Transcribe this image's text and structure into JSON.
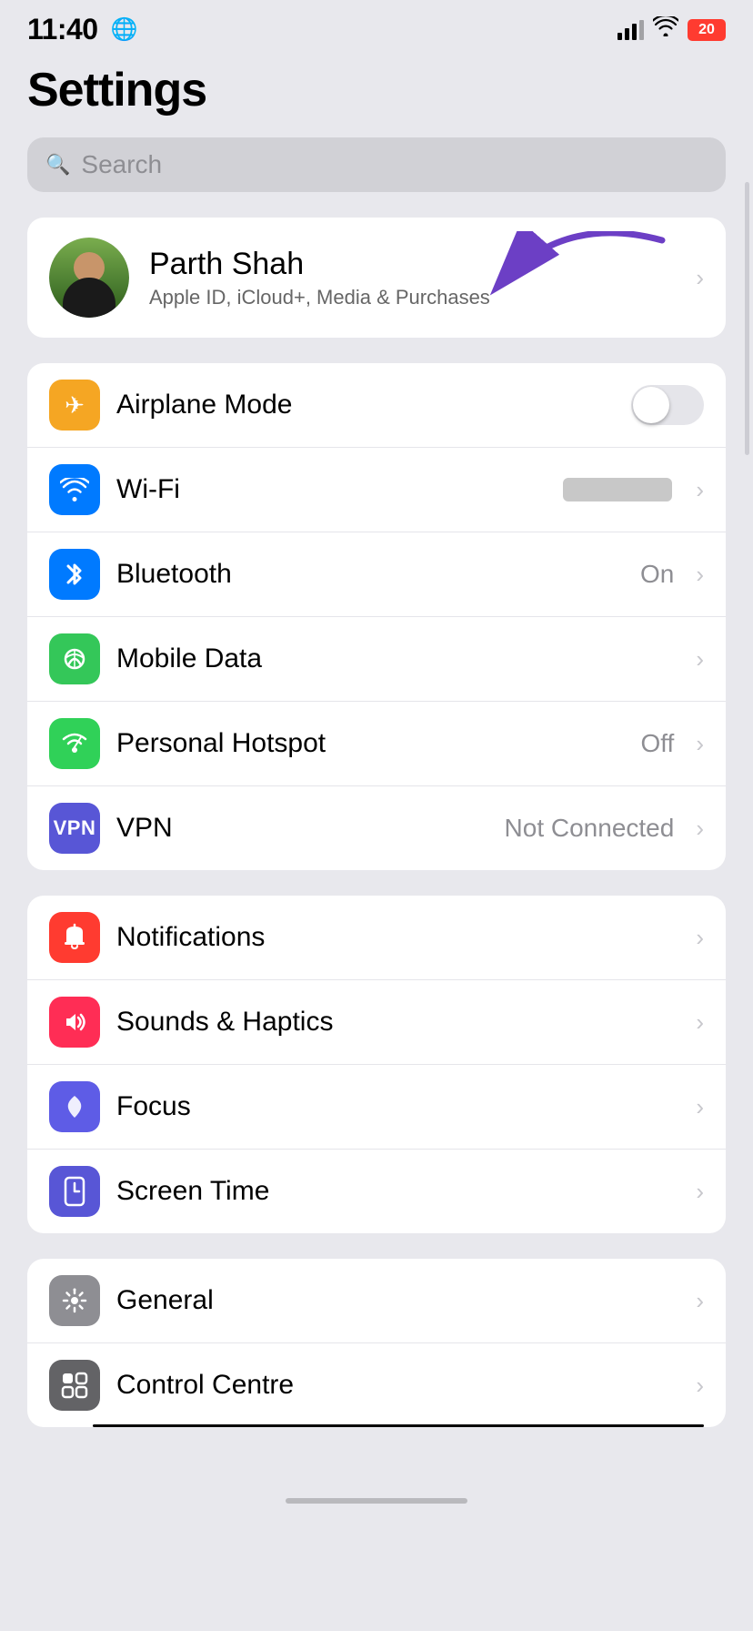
{
  "statusBar": {
    "time": "11:40",
    "battery": "20",
    "globeIcon": "🌐"
  },
  "page": {
    "title": "Settings",
    "searchPlaceholder": "Search"
  },
  "profile": {
    "name": "Parth Shah",
    "subtitle": "Apple ID, iCloud+, Media & Purchases"
  },
  "connectivitySection": [
    {
      "id": "airplane-mode",
      "label": "Airplane Mode",
      "iconBg": "icon-orange",
      "iconSymbol": "✈",
      "hasToggle": true,
      "toggleOn": false,
      "value": "",
      "hasChevron": false
    },
    {
      "id": "wifi",
      "label": "Wi-Fi",
      "iconBg": "icon-blue",
      "iconSymbol": "wifi",
      "hasToggle": false,
      "value": "",
      "hasBlurValue": true,
      "hasChevron": true
    },
    {
      "id": "bluetooth",
      "label": "Bluetooth",
      "iconBg": "icon-blue-bt",
      "iconSymbol": "bt",
      "hasToggle": false,
      "value": "On",
      "hasChevron": true
    },
    {
      "id": "mobile-data",
      "label": "Mobile Data",
      "iconBg": "icon-green",
      "iconSymbol": "signal",
      "hasToggle": false,
      "value": "",
      "hasChevron": true
    },
    {
      "id": "personal-hotspot",
      "label": "Personal Hotspot",
      "iconBg": "icon-green-hs",
      "iconSymbol": "hotspot",
      "hasToggle": false,
      "value": "Off",
      "hasChevron": true
    },
    {
      "id": "vpn",
      "label": "VPN",
      "iconBg": "icon-blue-vpn",
      "iconSymbol": "VPN",
      "hasToggle": false,
      "value": "Not Connected",
      "hasChevron": true
    }
  ],
  "notificationsSection": [
    {
      "id": "notifications",
      "label": "Notifications",
      "iconBg": "icon-red",
      "iconSymbol": "bell",
      "value": "",
      "hasChevron": true
    },
    {
      "id": "sounds-haptics",
      "label": "Sounds & Haptics",
      "iconBg": "icon-pink",
      "iconSymbol": "speaker",
      "value": "",
      "hasChevron": true
    },
    {
      "id": "focus",
      "label": "Focus",
      "iconBg": "icon-purple",
      "iconSymbol": "moon",
      "value": "",
      "hasChevron": true
    },
    {
      "id": "screen-time",
      "label": "Screen Time",
      "iconBg": "icon-indigo",
      "iconSymbol": "hourglass",
      "value": "",
      "hasChevron": true
    }
  ],
  "generalSection": [
    {
      "id": "general",
      "label": "General",
      "iconBg": "icon-gray",
      "iconSymbol": "gear",
      "value": "",
      "hasChevron": true
    },
    {
      "id": "control-centre",
      "label": "Control Centre",
      "iconBg": "icon-dark-gray",
      "iconSymbol": "toggle",
      "value": "",
      "hasChevron": true
    }
  ],
  "labels": {
    "on": "On",
    "off": "Off",
    "notConnected": "Not Connected"
  }
}
